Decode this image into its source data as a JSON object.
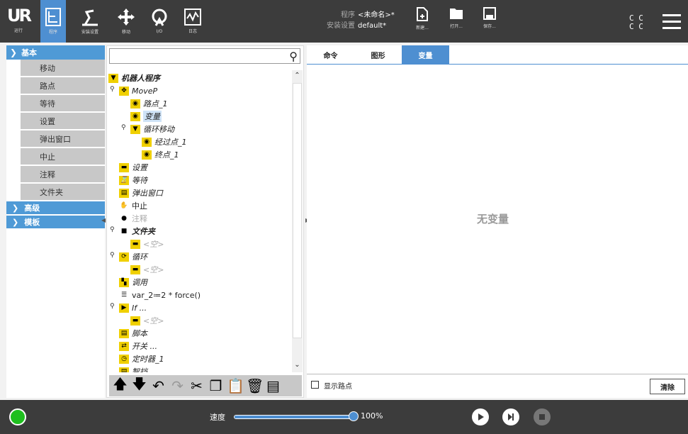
{
  "topbar": {
    "logo_label": "运行",
    "nav": [
      {
        "label": "程序",
        "icon": "program-icon"
      },
      {
        "label": "安装设置",
        "icon": "installation-icon"
      },
      {
        "label": "移动",
        "icon": "move-icon"
      },
      {
        "label": "I/O",
        "icon": "io-icon"
      },
      {
        "label": "日志",
        "icon": "log-icon"
      }
    ],
    "program_key": "程序",
    "program_value": "<未命名>*",
    "install_key": "安装设置",
    "install_value": "default*",
    "file_buttons": [
      {
        "label": "新建...",
        "icon": "new-file-icon"
      },
      {
        "label": "打开...",
        "icon": "open-folder-icon"
      },
      {
        "label": "保存...",
        "icon": "save-icon"
      }
    ],
    "cc_line1": "C C",
    "cc_line2": "C C"
  },
  "commands": {
    "basic_label": "基本",
    "basic_items": [
      "移动",
      "路点",
      "等待",
      "设置",
      "弹出窗口",
      "中止",
      "注释",
      "文件夹"
    ],
    "advanced_label": "高级",
    "templates_label": "模板"
  },
  "tree": {
    "nodes": [
      {
        "text": "机器人程序",
        "icon": "robot-program-icon"
      },
      {
        "text": "MoveP",
        "icon": "move-icon"
      },
      {
        "text": "路点_1",
        "icon": "waypoint-icon"
      },
      {
        "text": "变量",
        "icon": "waypoint-icon"
      },
      {
        "text": "循环移动",
        "icon": "circle-move-icon"
      },
      {
        "text": "经过点_1",
        "icon": "waypoint-icon"
      },
      {
        "text": "终点_1",
        "icon": "waypoint-icon"
      },
      {
        "text": "设置",
        "icon": "set-icon"
      },
      {
        "text": "等待",
        "icon": "wait-icon"
      },
      {
        "text": "弹出窗口",
        "icon": "popup-icon"
      },
      {
        "text": "中止",
        "icon": "halt-icon"
      },
      {
        "text": "注释",
        "icon": "comment-icon"
      },
      {
        "text": "文件夹",
        "icon": "folder-icon"
      },
      {
        "text": "<空>",
        "icon": "empty-icon"
      },
      {
        "text": "循环",
        "icon": "loop-icon"
      },
      {
        "text": "<空>",
        "icon": "empty-icon"
      },
      {
        "text": "调用",
        "icon": "call-icon"
      },
      {
        "text": "var_2≔2 * force()",
        "icon": "assignment-icon"
      },
      {
        "text": "If ...",
        "icon": "if-icon"
      },
      {
        "text": "<空>",
        "icon": "empty-icon"
      },
      {
        "text": "脚本",
        "icon": "script-icon"
      },
      {
        "text": "开关 ...",
        "icon": "switch-icon"
      },
      {
        "text": "定时器_1",
        "icon": "timer-icon"
      },
      {
        "text": "智挡",
        "icon": "pallet-icon"
      }
    ]
  },
  "right": {
    "tabs": [
      "命令",
      "图形",
      "变量"
    ],
    "empty_text": "无变量",
    "show_waypoints": "显示路点",
    "clear_label": "清除"
  },
  "footer": {
    "speed_label": "速度",
    "speed_value": "100%",
    "speed_fraction": 1.0
  }
}
